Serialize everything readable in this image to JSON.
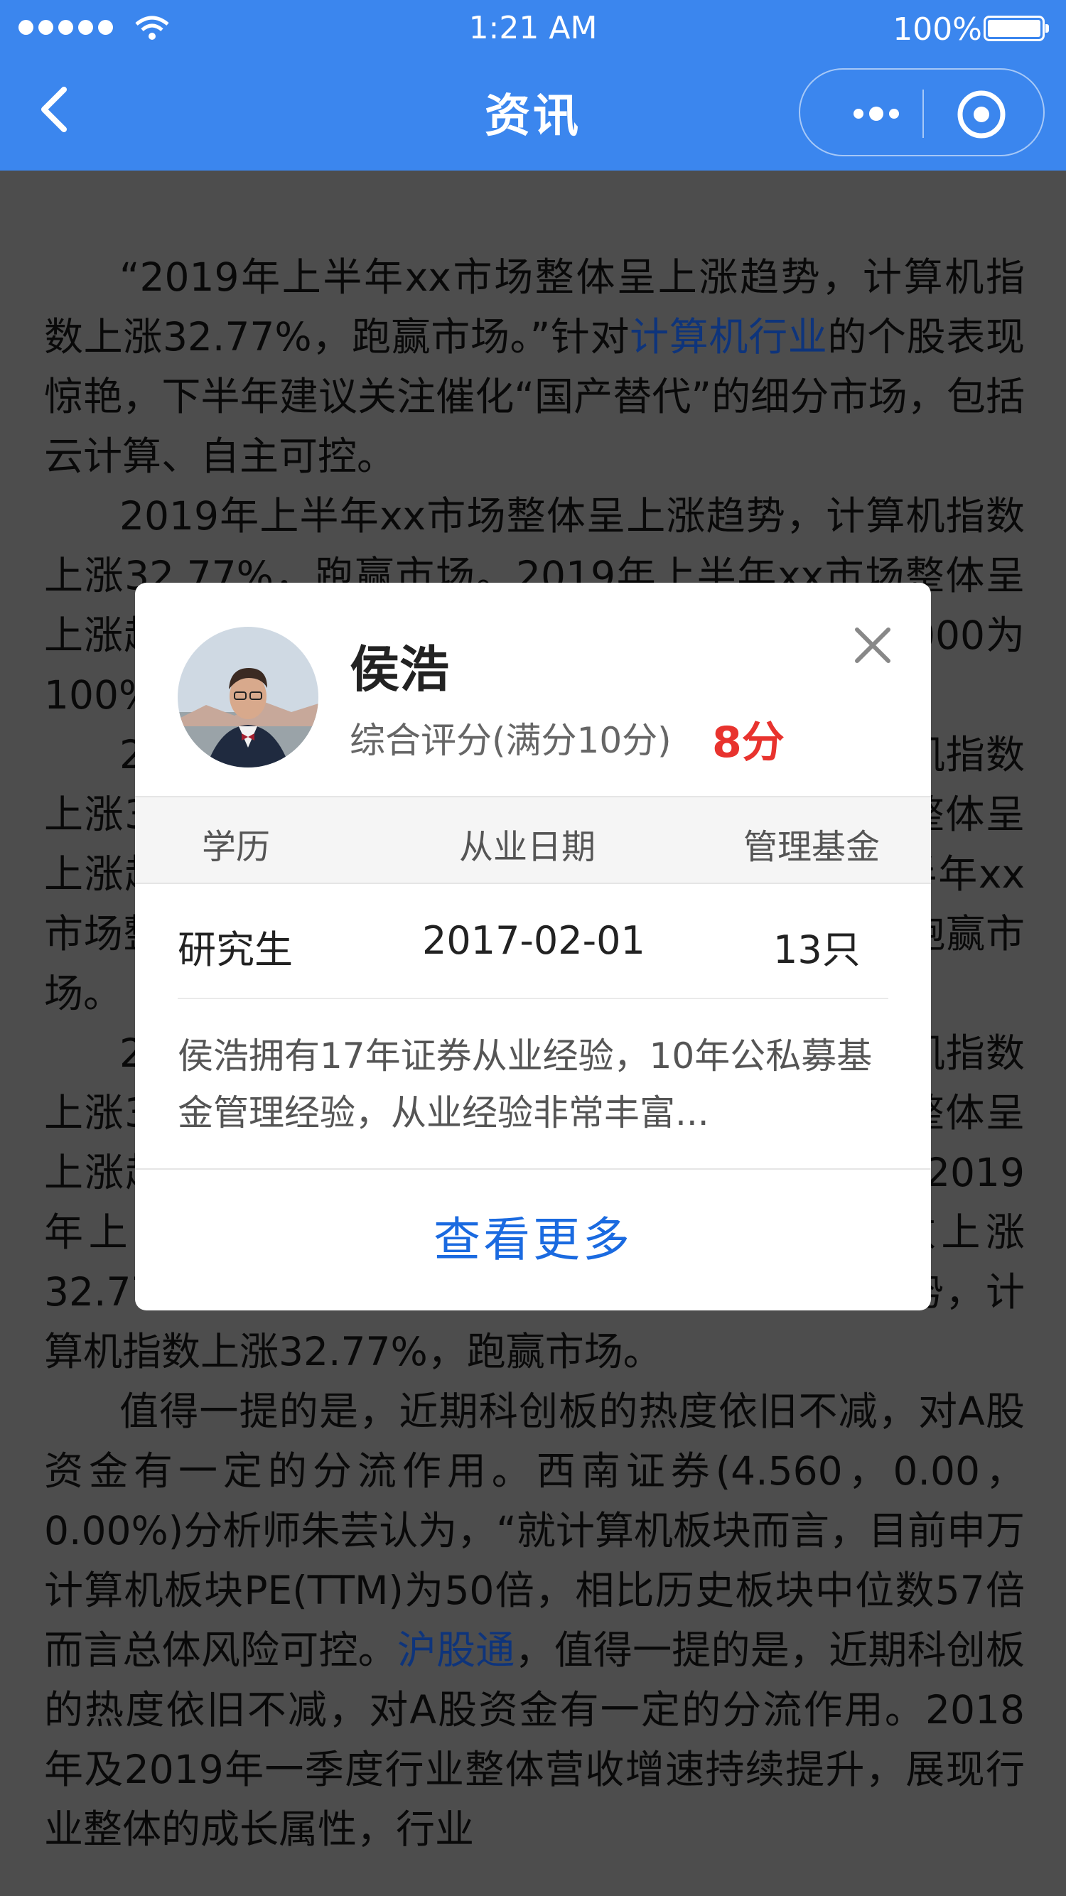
{
  "status_bar": {
    "time": "1:21 AM",
    "battery": "100%"
  },
  "nav": {
    "title": "资讯"
  },
  "article": {
    "p1_a": "“2019年上半年xx市场整体呈上涨趋势，计算机指数上涨32.77%，跑赢市场。”针对",
    "p1_link": "计算机行业",
    "p1_b": "的个股表现惊艳，下半年建议关注催化“国产替代”的细分市场，包括云计算、自主可控。",
    "p2": "2019年上半年xx市场整体呈上涨趋势，计算机指数上涨32.77%，跑赢市场。2019年上半年xx市场整体呈上涨趋势，计算机指数上涨32.77%，跑赢市场。000为100%。",
    "p3": "2019年上半年xx市场整体呈上涨趋势，计算机指数上涨32.77%，跑赢市场。2019年上半年xx市场整体呈上涨趋势，计算机指数上涨32.77%。2019年上半年xx市场整体呈上涨趋势，计算机指数上涨32.77%，跑赢市场。",
    "p4": "2019年上半年xx市场整体呈上涨趋势，计算机指数上涨32.77%，跑赢市场。2019年上半年xx市场整体呈上涨趋势，计算机指数上涨32.77%，跑赢市场。2019年上半年xx市场整体呈上涨趋势，计算机指数上涨32.77%……2019年上半年xx市场整体呈上涨趋势，计算机指数上涨32.77%，跑赢市场。",
    "p5_a": "值得一提的是，近期科创板的热度依旧不减，对A股资金有一定的分流作用。西南证券(4.560，0.00，0.00%)分析师朱芸认为，“就计算机板块而言，目前申万计算机板块PE(TTM)为50倍，相比历史板块中位数57倍而言总体风险可控。",
    "p5_link": "沪股通",
    "p5_b": "，值得一提的是，近期科创板的热度依旧不减，对A股资金有一定的分流作用。2018年及2019年一季度行业整体营收增速持续提升，展现行业整体的成长属性，行业"
  },
  "modal": {
    "name": "侯浩",
    "rating_label": "综合评分(满分10分)",
    "rating_score": "8分",
    "headers": {
      "education": "学历",
      "start_date": "从业日期",
      "funds": "管理基金"
    },
    "values": {
      "education": "研究生",
      "start_date": "2017-02-01",
      "funds": "13只"
    },
    "bio": "侯浩拥有17年证券从业经验，10年公私募基金管理经验，从业经验非常丰富...",
    "view_more": "查看更多"
  },
  "colors": {
    "nav_bg": "#3b86ee",
    "link": "#1a5fe0",
    "score": "#e8332e"
  }
}
